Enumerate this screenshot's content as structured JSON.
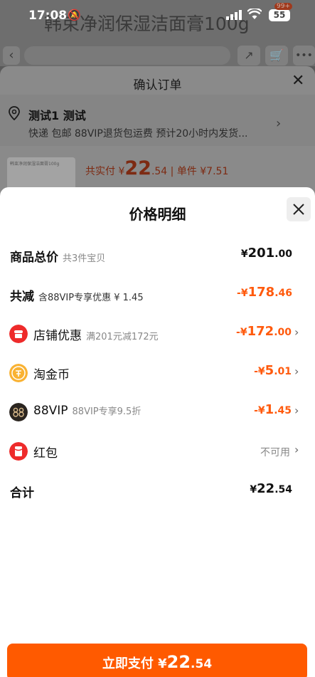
{
  "status_bar": {
    "time": "17:08",
    "battery": "55"
  },
  "background": {
    "product_title": "韩束净润保湿洁面膏100g",
    "cart_badge": "99+",
    "confirm_title": "确认订单",
    "address_name": "测试1 测试",
    "address_sub": "快递 包邮 88VIP退货包运费 预计20小时内发货...",
    "thumb_text": "韩束净润保湿洁面膏100g",
    "pay_prefix": "共实付 ¥",
    "pay_big": "22",
    "pay_dec": ".54",
    "unit_price": "| 单件 ¥7.51"
  },
  "sheet": {
    "title": "价格明细",
    "rows": [
      {
        "label": "商品总价",
        "sub": "共3件宝贝",
        "yen": "¥",
        "int": "201",
        "dec": ".00"
      },
      {
        "label": "共减",
        "sub": "含88VIP专享优惠 ¥ 1.45",
        "yen": "-¥",
        "int": "178",
        "dec": ".46"
      },
      {
        "label": "店铺优惠",
        "sub": "满201元减172元",
        "yen": "-¥",
        "int": "172",
        "dec": ".00",
        "icon": "shop-icon"
      },
      {
        "label": "淘金币",
        "sub": "",
        "yen": "-¥",
        "int": "5",
        "dec": ".01",
        "icon": "coin-icon"
      },
      {
        "label": "88VIP",
        "sub": "88VIP专享9.5折",
        "yen": "-¥",
        "int": "1",
        "dec": ".45",
        "icon": "vip-icon"
      },
      {
        "label": "红包",
        "sub": "",
        "status": "不可用",
        "icon": "red-packet-icon"
      },
      {
        "label": "合计",
        "sub": "",
        "yen": "¥",
        "int": "22",
        "dec": ".54"
      }
    ],
    "pay_button": {
      "prefix": "立即支付 ¥",
      "int": "22",
      "dec": ".54"
    }
  },
  "colors": {
    "accent": "#ff5a00",
    "discount": "#ff5a0d"
  }
}
